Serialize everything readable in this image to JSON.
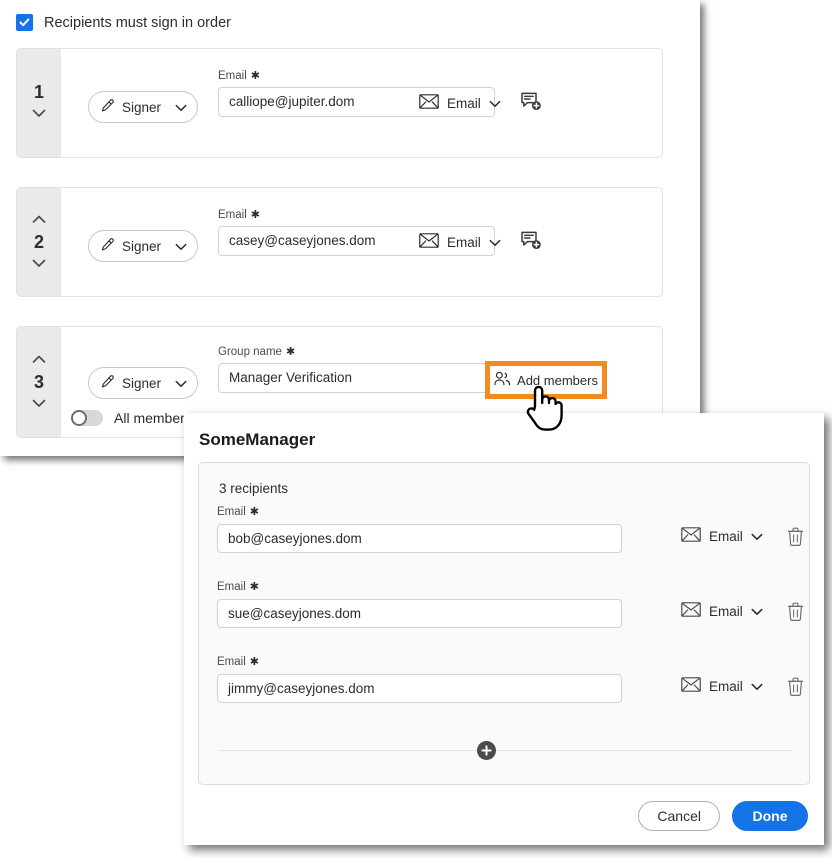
{
  "colors": {
    "accent_blue": "#1473E6",
    "highlight_orange": "#F28C1E",
    "order_column_gray": "#EAEAEA",
    "card_gray": "#FAFAFA"
  },
  "background_panel": {
    "sign_in_order": {
      "label": "Recipients must sign in order",
      "checked": true
    },
    "recipients": [
      {
        "order": "1",
        "role": "Signer",
        "field_label": "Email",
        "required_mark": "✱",
        "value": "calliope@jupiter.dom",
        "delivery": "Email",
        "has_up_chevron": false,
        "has_down_chevron": true,
        "type": "individual"
      },
      {
        "order": "2",
        "role": "Signer",
        "field_label": "Email",
        "required_mark": "✱",
        "value": "casey@caseyjones.dom",
        "delivery": "Email",
        "has_up_chevron": true,
        "has_down_chevron": true,
        "type": "individual"
      },
      {
        "order": "3",
        "role": "Signer",
        "field_label": "Group name",
        "required_mark": "✱",
        "value": "Manager Verification",
        "add_members_label": "Add members",
        "has_up_chevron": true,
        "has_down_chevron": true,
        "type": "group",
        "all_members_toggle": {
          "label": "All members m",
          "on": false
        }
      }
    ]
  },
  "dialog": {
    "title": "SomeManager",
    "recipients_count_label": "3 recipients",
    "members": [
      {
        "field_label": "Email",
        "required_mark": "✱",
        "value": "bob@caseyjones.dom",
        "delivery": "Email"
      },
      {
        "field_label": "Email",
        "required_mark": "✱",
        "value": "sue@caseyjones.dom",
        "delivery": "Email"
      },
      {
        "field_label": "Email",
        "required_mark": "✱",
        "value": "jimmy@caseyjones.dom",
        "delivery": "Email"
      }
    ],
    "footer": {
      "cancel_label": "Cancel",
      "done_label": "Done"
    }
  }
}
